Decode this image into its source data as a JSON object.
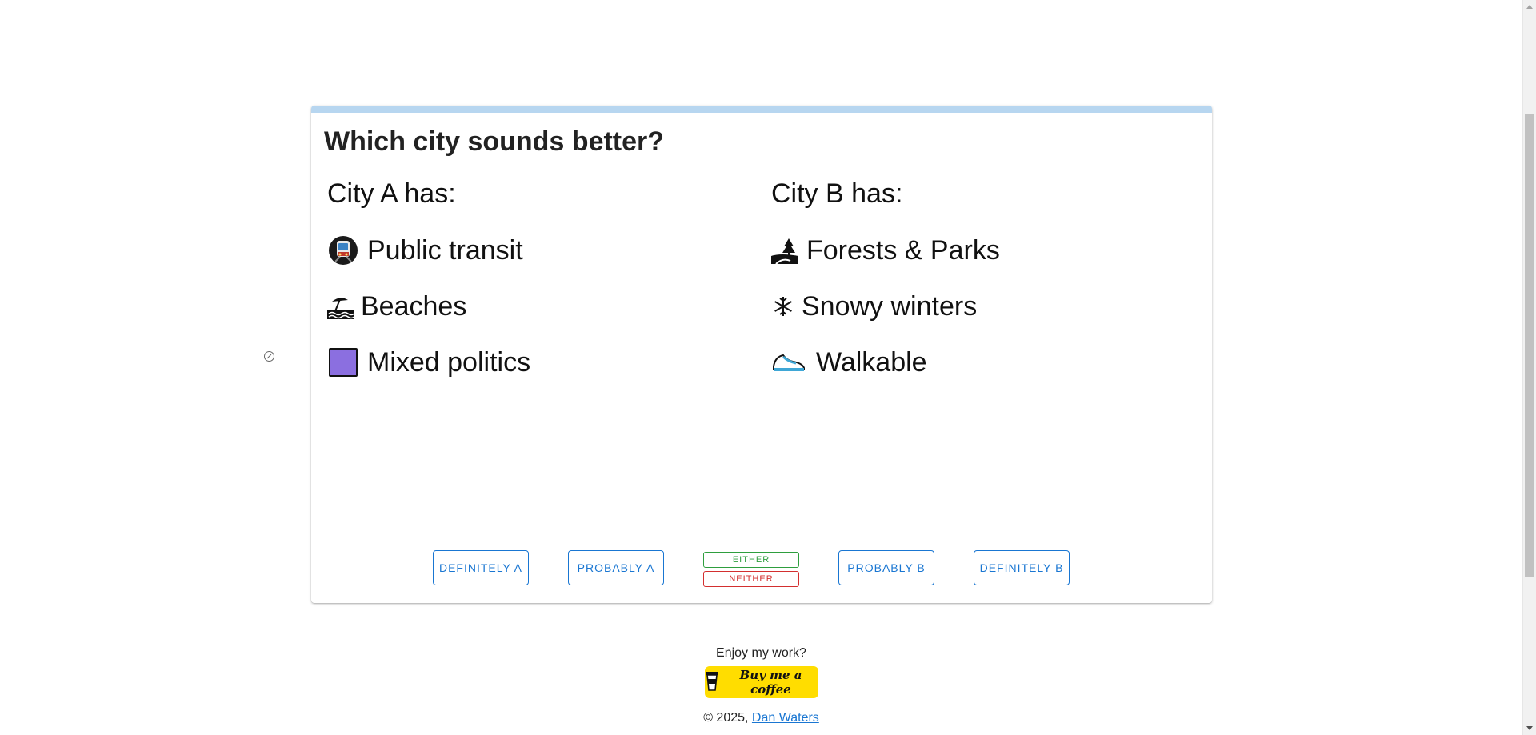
{
  "quiz": {
    "title": "Which city sounds better?",
    "progress": 0.0,
    "city_a": {
      "heading": "City A has:",
      "features": [
        {
          "icon": "train-icon",
          "label": "Public transit"
        },
        {
          "icon": "beach-icon",
          "label": "Beaches"
        },
        {
          "icon": "purple-square-icon",
          "label": "Mixed politics"
        }
      ]
    },
    "city_b": {
      "heading": "City B has:",
      "features": [
        {
          "icon": "park-icon",
          "label": "Forests & Parks"
        },
        {
          "icon": "snowflake-icon",
          "label": "Snowy winters"
        },
        {
          "icon": "sneaker-icon",
          "label": "Walkable"
        }
      ]
    },
    "buttons": {
      "definitely_a": "Definitely A",
      "probably_a": "Probably A",
      "either": "Either",
      "neither": "Neither",
      "probably_b": "Probably B",
      "definitely_b": "Definitely B"
    }
  },
  "colors": {
    "primary": "#1976d2",
    "progress_track": "#b7d6f0",
    "either": "#2e9e3e",
    "neither": "#d32f2f",
    "coffee": "#ffdd00",
    "politics_square": "#8b6fe0"
  },
  "footer": {
    "enjoy": "Enjoy my work?",
    "coffee_label": "Buy me a coffee",
    "copyright": "© 2025,",
    "author": "Dan Waters"
  }
}
